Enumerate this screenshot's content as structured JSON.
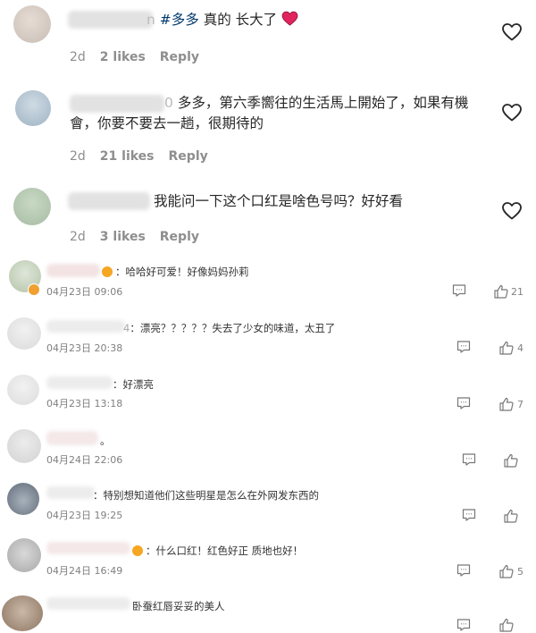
{
  "instagram_comments": [
    {
      "text_hash": "#多多",
      "text": " 真的 长大了",
      "name_tail": "n",
      "time": "2d",
      "likes": "2 likes",
      "reply": "Reply"
    },
    {
      "name_tail": "0",
      "text_line1": "多多，第六季嚮往的生活馬上開始了，如果有機",
      "text_line2": "會，你要不要去一趟，很期待的",
      "time": "2d",
      "likes": "21 likes",
      "reply": "Reply"
    },
    {
      "text": "我能问一下这个口红是啥色号吗？好好看",
      "time": "2d",
      "likes": "3 likes",
      "reply": "Reply"
    }
  ],
  "weibo_comments": [
    {
      "text": "：哈哈好可爱！好像妈妈孙莉",
      "time": "04月23日 09:06",
      "likes": "21"
    },
    {
      "name_tail": "4",
      "text": "：漂亮？？？？？失去了少女的味道，太丑了",
      "time": "04月23日 20:38",
      "likes": "4"
    },
    {
      "text": "：好漂亮",
      "time": "04月23日 13:18",
      "likes": "7"
    },
    {
      "text": "。",
      "time": "04月24日 22:06",
      "likes": ""
    },
    {
      "text": "：特别想知道他们这些明星是怎么在外网发东西的",
      "time": "04月23日 19:25",
      "likes": ""
    },
    {
      "text": "：什么口红！红色好正 质地也好！",
      "time": "04月24日 16:49",
      "likes": "5"
    },
    {
      "text": "卧蚕红唇妥妥的美人",
      "time": "",
      "likes": ""
    }
  ],
  "icons": {
    "ig_like": "heart-outline-icon",
    "ig_heart_emoji": "red-heart-emoji",
    "wb_reply": "comment-bubble-icon",
    "wb_like": "thumbs-up-icon"
  },
  "colors": {
    "hashtag": "#00376b",
    "heart_emoji": "#e0245e",
    "meta": "#8e8e8e"
  }
}
